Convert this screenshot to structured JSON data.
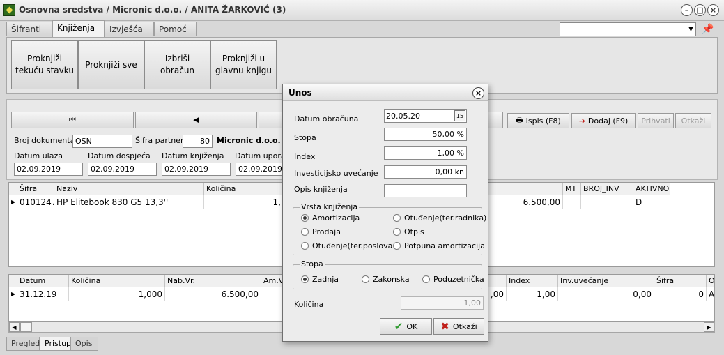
{
  "window": {
    "title": "Osnovna sredstva / Micronic d.o.o. / ANITA ŽARKOVIĆ (3)",
    "minimize": "–",
    "maximize": "□",
    "close": "×"
  },
  "tabs": [
    "Šifranti",
    "Knjiženja",
    "Izvješća",
    "Pomoć"
  ],
  "ribbon": {
    "buttons": [
      "Proknjiži tekuću stavku",
      "Proknjiži sve",
      "Izbriši obračun",
      "Proknjiži u glavnu knjigu"
    ]
  },
  "nav": {
    "first": "⏮",
    "prev": "◀",
    "print": "Ispis (F8)",
    "add": "Dodaj (F9)",
    "accept": "Prihvati",
    "cancel": "Otkaži"
  },
  "header": {
    "doc_label": "Broj dokumenta",
    "doc_value": "OSN",
    "partner_label": "Šifra partnera",
    "partner_code": "80",
    "partner_name": "Micronic d.o.o.",
    "dates": [
      {
        "label": "Datum ulaza",
        "value": "02.09.2019"
      },
      {
        "label": "Datum dospjeća",
        "value": "02.09.2019"
      },
      {
        "label": "Datum knjiženja",
        "value": "02.09.2019"
      },
      {
        "label": "Datum uporabe",
        "value": "02.09.2019"
      }
    ]
  },
  "grid1": {
    "headers": [
      "Šifra",
      "Naziv",
      "Količina",
      "MT",
      "BROJ_INV",
      "AKTIVNO"
    ],
    "row": {
      "sifra": "0101247",
      "naziv": "HP Elitebook 830 G5 13,3''",
      "kolicina": "1,",
      "value": "6.500,00",
      "aktivno": "D"
    }
  },
  "grid2": {
    "headers": [
      "Datum",
      "Količina",
      "Nab.Vr.",
      "Am.Vr",
      "Index",
      "Inv.uvećanje",
      "Šifra",
      "O"
    ],
    "row": {
      "datum": "31.12.19",
      "kolicina": "1,000",
      "nabvr": "6.500,00",
      "col_before_index": ",00",
      "index": "1,00",
      "inv": "0,00",
      "sifra": "0",
      "o": "A"
    }
  },
  "bottom_tabs": [
    "Pregled",
    "Pristup",
    "Opis"
  ],
  "dialog": {
    "title": "Unos",
    "fields": [
      {
        "label": "Datum obračuna",
        "value": "20.05.20"
      },
      {
        "label": "Stopa",
        "value": "50,00 %"
      },
      {
        "label": "Index",
        "value": "1,00 %"
      },
      {
        "label": "Investicijsko uvećanje",
        "value": "0,00 kn"
      },
      {
        "label": "Opis knjiženja",
        "value": ""
      }
    ],
    "vrsta_label": "Vrsta knjiženja",
    "vrsta_options": [
      "Amortizacija",
      "Otuđenje(ter.radnika)",
      "Prodaja",
      "Otpis",
      "Otuđenje(ter.poslovanja)",
      "Potpuna amortizacija"
    ],
    "vrsta_selected": 0,
    "stopa_label": "Stopa",
    "stopa_options": [
      "Zadnja",
      "Zakonska",
      "Poduzetnička"
    ],
    "stopa_selected": 0,
    "kolicina_label": "Količina",
    "kolicina_value": "1,00",
    "ok": "OK",
    "cancel": "Otkaži"
  },
  "colors": {
    "ok_check": "#2e9a2e",
    "cancel_x": "#c0201a"
  }
}
